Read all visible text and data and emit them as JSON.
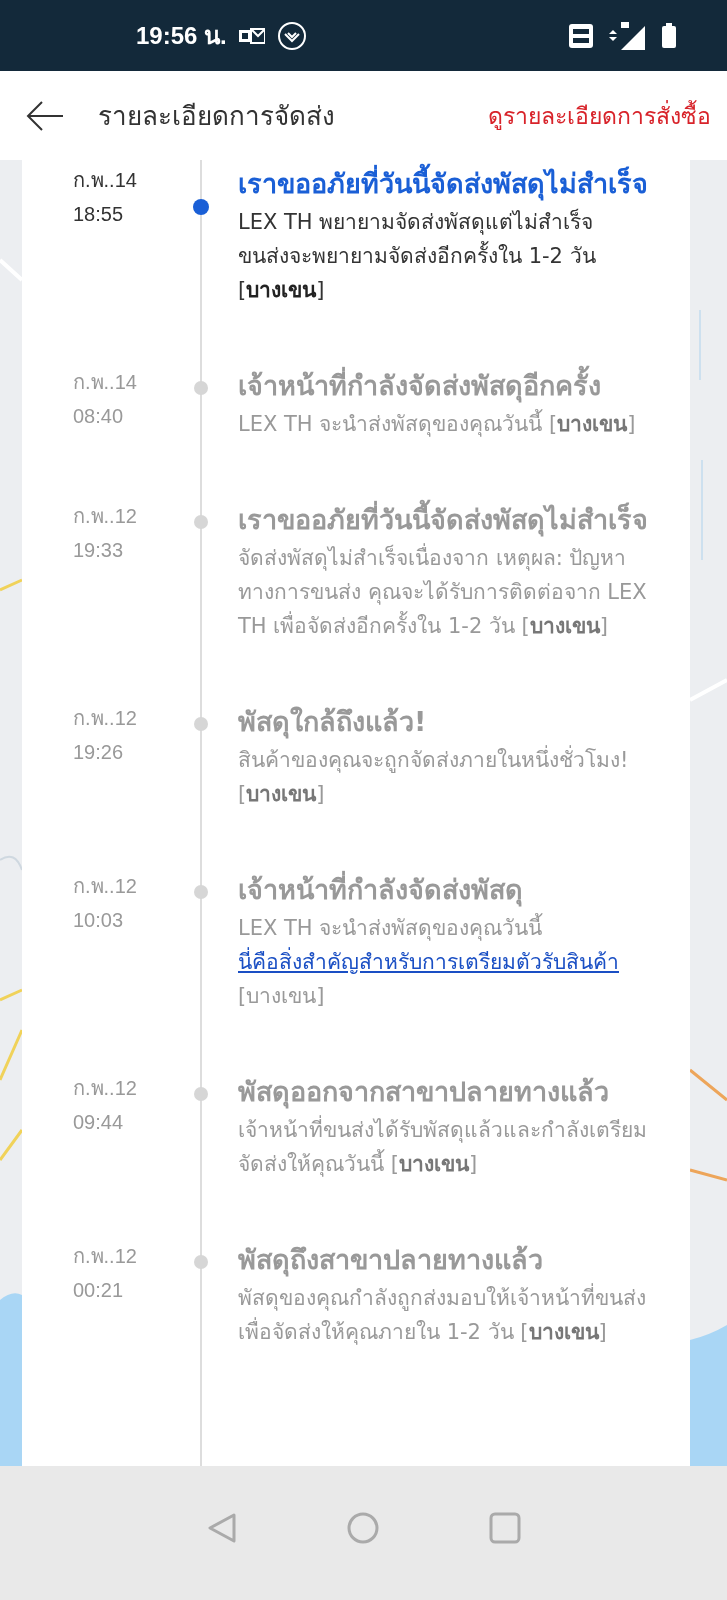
{
  "status_bar": {
    "time": "19:56 น."
  },
  "header": {
    "title": "รายละเอียดการจัดส่ง",
    "action": "ดูรายละเอียดการสั่งซื้อ"
  },
  "events": [
    {
      "date": "ก.พ..14",
      "time": "18:55",
      "current": true,
      "title": "เราขออภัยที่วันนี้จัดส่งพัสดุไม่สำเร็จ",
      "description": "LEX TH พยายามจัดส่งพัสดุแต่ไม่สำเร็จ ขนส่งจะพยายามจัดส่งอีกครั้งใน 1-2 วัน [**บางเขน**]"
    },
    {
      "date": "ก.พ..14",
      "time": "08:40",
      "current": false,
      "title": "เจ้าหน้าที่กำลังจัดส่งพัสดุอีกครั้ง",
      "description": "LEX TH จะนำส่งพัสดุของคุณวันนี้ [**บางเขน**]"
    },
    {
      "date": "ก.พ..12",
      "time": "19:33",
      "current": false,
      "title": "เราขออภัยที่วันนี้จัดส่งพัสดุไม่สำเร็จ",
      "description": "จัดส่งพัสดุไม่สำเร็จเนื่องจาก เหตุผล: ปัญหาทางการขนส่ง คุณจะได้รับการติดต่อจาก LEX TH เพื่อจัดส่งอีกครั้งใน 1-2 วัน [**บางเขน**]"
    },
    {
      "date": "ก.พ..12",
      "time": "19:26",
      "current": false,
      "title": "พัสดุใกล้ถึงแล้ว!",
      "description": "สินค้าของคุณจะถูกจัดส่งภายในหนึ่งชั่วโมง! [**บางเขน**]"
    },
    {
      "date": "ก.พ..12",
      "time": "10:03",
      "current": false,
      "title": "เจ้าหน้าที่กำลังจัดส่งพัสดุ",
      "description": "LEX TH จะนำส่งพัสดุของคุณวันนี้",
      "link": "นี่คือสิ่งสำคัญสำหรับการเตรียมตัวรับสินค้า",
      "after": "[บางเขน]"
    },
    {
      "date": "ก.พ..12",
      "time": "09:44",
      "current": false,
      "title": "พัสดุออกจากสาขาปลายทางแล้ว",
      "description": "เจ้าหน้าที่ขนส่งได้รับพัสดุแล้วและกำลังเตรียมจัดส่งให้คุณวันนี้ [**บางเขน**]"
    },
    {
      "date": "ก.พ..12",
      "time": "00:21",
      "current": false,
      "title": "พัสดุถึงสาขาปลายทางแล้ว",
      "description": "พัสดุของคุณกำลังถูกส่งมอบให้เจ้าหน้าที่ขนส่งเพื่อจัดส่งให้คุณภายใน 1-2 วัน [**บางเขน**]"
    }
  ]
}
